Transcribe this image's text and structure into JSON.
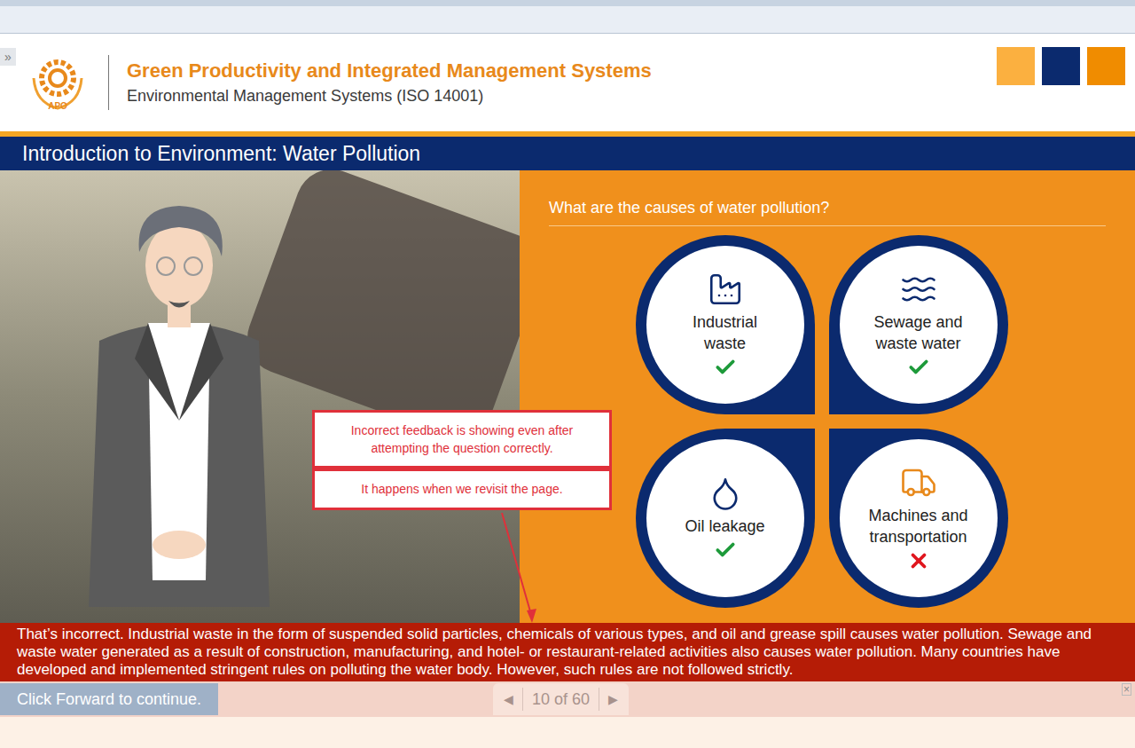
{
  "top_bar": {
    "toggle": "»"
  },
  "header": {
    "logo": "APO",
    "title": "Green Productivity and Integrated Management Systems",
    "subtitle": "Environmental Management Systems (ISO 14001)",
    "squares": [
      {
        "color": "#fbb040"
      },
      {
        "color": "#0b2a6e"
      },
      {
        "color": "#f08c00"
      }
    ]
  },
  "slide": {
    "title": "Introduction to Environment: Water Pollution",
    "question": "What are the causes of water pollution?",
    "options": [
      {
        "label": "Industrial waste",
        "correct": true
      },
      {
        "label": "Sewage and waste water",
        "correct": true
      },
      {
        "label": "Oil leakage",
        "correct": true
      },
      {
        "label": "Machines and transportation",
        "correct": false
      }
    ]
  },
  "annotations": [
    "Incorrect feedback is showing even after attempting the question correctly.",
    "It happens when we revisit the page."
  ],
  "feedback": {
    "text": "That’s incorrect. Industrial waste in the form of suspended solid particles, chemicals of various types, and oil and grease spill causes water pollution. Sewage and waste water generated as a result of construction, manufacturing, and hotel- or restaurant-related activities also causes water pollution. Many countries have developed and implemented stringent rules on polluting the water body. However, such rules are not followed strictly.",
    "close": "×"
  },
  "footer": {
    "continue": "Click Forward to continue.",
    "prev": "◀",
    "page": "10 of 60",
    "next": "▶"
  }
}
